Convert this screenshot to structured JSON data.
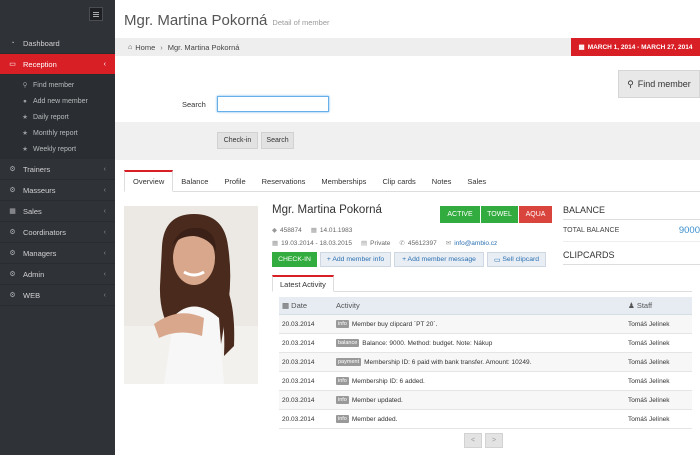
{
  "sidebar": {
    "items": [
      {
        "label": "Dashboard",
        "icon": "dashboard-icon"
      },
      {
        "label": "Reception",
        "icon": "monitor-icon"
      },
      {
        "label": "Trainers",
        "icon": "cogs-icon"
      },
      {
        "label": "Masseurs",
        "icon": "cogs-icon"
      },
      {
        "label": "Sales",
        "icon": "table-icon"
      },
      {
        "label": "Coordinators",
        "icon": "cogs-icon"
      },
      {
        "label": "Managers",
        "icon": "cogs-icon"
      },
      {
        "label": "Admin",
        "icon": "cogs-icon"
      },
      {
        "label": "WEB",
        "icon": "cogs-icon"
      }
    ],
    "reception_sub": [
      {
        "label": "Find member",
        "icon": "search-icon"
      },
      {
        "label": "Add new member",
        "icon": "user-icon"
      },
      {
        "label": "Daily report",
        "icon": "star-icon"
      },
      {
        "label": "Monthly report",
        "icon": "star-icon"
      },
      {
        "label": "Weekly report",
        "icon": "star-icon"
      }
    ]
  },
  "header": {
    "title": "Mgr. Martina Pokorná",
    "subtitle": "Detail of member",
    "breadcrumb_home": "Home",
    "breadcrumb_current": "Mgr. Martina Pokorná",
    "date_range": "MARCH 1, 2014 - MARCH 27, 2014"
  },
  "search": {
    "find_member_label": "Find member",
    "label": "Search",
    "value": "",
    "checkin_label": "Check-in",
    "search_label": "Search"
  },
  "tabs": [
    "Overview",
    "Balance",
    "Profile",
    "Reservations",
    "Memberships",
    "Clip cards",
    "Notes",
    "Sales"
  ],
  "member": {
    "name": "Mgr. Martina Pokorná",
    "statuses": {
      "active": "ACTIVE",
      "towel": "TOWEL",
      "aqua": "AQUA"
    },
    "id": "458874",
    "birthdate": "14.01.1983",
    "period": "19.03.2014 - 18.03.2015",
    "type": "Private",
    "phone": "45612397",
    "email": "info@ambio.cz",
    "checkin_label": "CHECK-IN",
    "add_info_label": "+ Add member info",
    "add_message_label": "+ Add member message",
    "sell_clipcard_label": "Sell clipcard"
  },
  "activity": {
    "tab_label": "Latest Activity",
    "headers": {
      "date": "Date",
      "activity": "Activity",
      "staff": "Staff"
    },
    "rows": [
      {
        "date": "20.03.2014",
        "tag": "info",
        "text": "Member buy clipcard ´PT 20´.",
        "staff": "Tomáš Jelínek"
      },
      {
        "date": "20.03.2014",
        "tag": "balance",
        "text": "Balance: 9000. Method: budget. Note: Nákup",
        "staff": "Tomáš Jelínek"
      },
      {
        "date": "20.03.2014",
        "tag": "payment",
        "text": "Membership ID: 6 paid with bank transfer. Amount: 10249.",
        "staff": "Tomáš Jelínek"
      },
      {
        "date": "20.03.2014",
        "tag": "info",
        "text": "Membership ID: 6 added.",
        "staff": "Tomáš Jelínek"
      },
      {
        "date": "20.03.2014",
        "tag": "info",
        "text": "Member updated.",
        "staff": "Tomáš Jelínek"
      },
      {
        "date": "20.03.2014",
        "tag": "info",
        "text": "Member added.",
        "staff": "Tomáš Jelínek"
      }
    ],
    "pager_prev": "<",
    "pager_next": ">"
  },
  "balance": {
    "heading": "BALANCE",
    "total_label": "TOTAL BALANCE",
    "total_value": "9000",
    "clipcards_heading": "CLIPCARDS"
  },
  "colors": {
    "accent": "#d91f26",
    "green": "#32ac3e",
    "link": "#2a6fb1",
    "sidebar": "#2f3237"
  }
}
